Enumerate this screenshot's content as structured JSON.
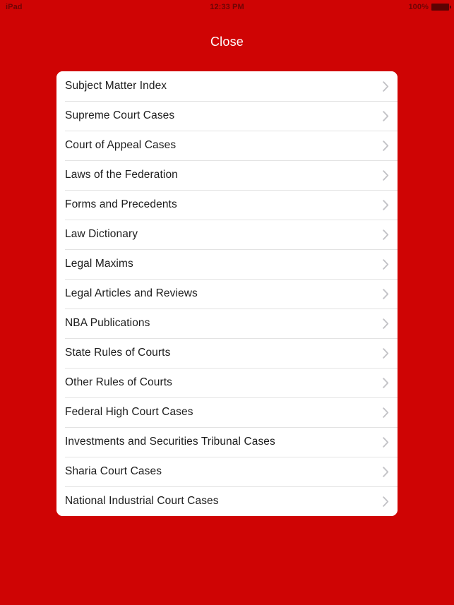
{
  "statusbar": {
    "device": "iPad",
    "time": "12:33 PM",
    "battery_percent": "100%",
    "battery_icon": "battery-full-icon"
  },
  "header": {
    "close_label": "Close"
  },
  "colors": {
    "background_red": "#cf0404",
    "card_white": "#ffffff",
    "separator": "#e3e3e3",
    "chevron_gray": "#c3c3c7",
    "row_text": "#1c1c1c",
    "status_text": "#6e0505",
    "close_text": "#ffffff"
  },
  "menu": {
    "items": [
      {
        "label": "Subject Matter Index",
        "accessory": "chevron-right-icon"
      },
      {
        "label": "Supreme Court Cases",
        "accessory": "chevron-right-icon"
      },
      {
        "label": "Court of Appeal Cases",
        "accessory": "chevron-right-icon"
      },
      {
        "label": "Laws of the Federation",
        "accessory": "chevron-right-icon"
      },
      {
        "label": "Forms and Precedents",
        "accessory": "chevron-right-icon"
      },
      {
        "label": "Law Dictionary",
        "accessory": "chevron-right-icon"
      },
      {
        "label": "Legal Maxims",
        "accessory": "chevron-right-icon"
      },
      {
        "label": "Legal Articles and Reviews",
        "accessory": "chevron-right-icon"
      },
      {
        "label": "NBA Publications",
        "accessory": "chevron-right-icon"
      },
      {
        "label": "State Rules of Courts",
        "accessory": "chevron-right-icon"
      },
      {
        "label": "Other Rules of Courts",
        "accessory": "chevron-right-icon"
      },
      {
        "label": "Federal High Court Cases",
        "accessory": "chevron-right-icon"
      },
      {
        "label": "Investments and Securities Tribunal Cases",
        "accessory": "chevron-right-icon"
      },
      {
        "label": "Sharia Court Cases",
        "accessory": "chevron-right-icon"
      },
      {
        "label": "National Industrial Court Cases",
        "accessory": "chevron-right-icon"
      }
    ]
  }
}
